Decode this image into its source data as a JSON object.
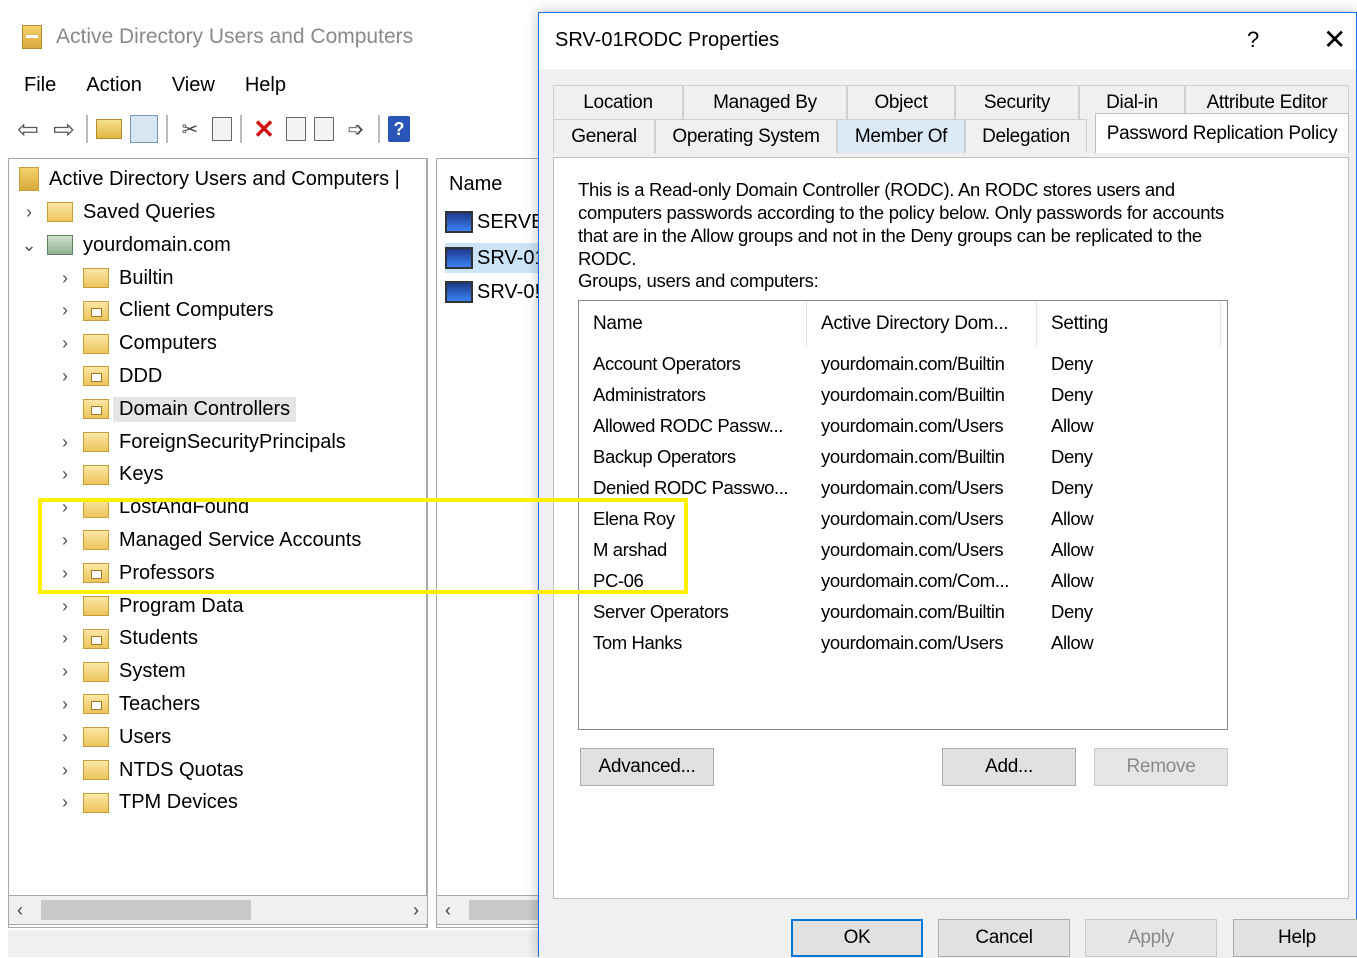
{
  "mmc": {
    "title": "Active Directory Users and Computers",
    "menu": [
      "File",
      "Action",
      "View",
      "Help"
    ],
    "tree": {
      "root": "Active Directory Users and Computers |",
      "saved_queries": "Saved Queries",
      "domain": "yourdomain.com",
      "children": [
        {
          "label": "Builtin",
          "ou": false
        },
        {
          "label": "Client Computers",
          "ou": true
        },
        {
          "label": "Computers",
          "ou": false
        },
        {
          "label": "DDD",
          "ou": true
        },
        {
          "label": "Domain Controllers",
          "ou": true,
          "selected": true
        },
        {
          "label": "ForeignSecurityPrincipals",
          "ou": false
        },
        {
          "label": "Keys",
          "ou": false
        },
        {
          "label": "LostAndFound",
          "ou": false
        },
        {
          "label": "Managed Service Accounts",
          "ou": false
        },
        {
          "label": "Professors",
          "ou": true
        },
        {
          "label": "Program Data",
          "ou": false
        },
        {
          "label": "Students",
          "ou": true
        },
        {
          "label": "System",
          "ou": false
        },
        {
          "label": "Teachers",
          "ou": true
        },
        {
          "label": "Users",
          "ou": false
        },
        {
          "label": "NTDS Quotas",
          "ou": false
        },
        {
          "label": "TPM Devices",
          "ou": false
        }
      ]
    },
    "list": {
      "header": "Name",
      "rows": [
        "SERVE",
        "SRV-01",
        "SRV-0!"
      ]
    }
  },
  "dialog": {
    "title": "SRV-01RODC Properties",
    "help": "?",
    "close": "✕",
    "tabs_row1": [
      "Location",
      "Managed By",
      "Object",
      "Security",
      "Dial-in",
      "Attribute Editor"
    ],
    "tabs_row2": [
      "General",
      "Operating System",
      "Member Of",
      "Delegation",
      "Password Replication Policy"
    ],
    "description": "This is a Read-only Domain Controller (RODC).  An RODC stores users and computers passwords according to the policy below.  Only passwords for accounts that are in the Allow groups and not in the Deny groups can be replicated to the RODC.",
    "groups_label": "Groups, users and computers:",
    "columns": [
      "Name",
      "Active Directory Dom...",
      "Setting"
    ],
    "rows": [
      {
        "name": "Account Operators",
        "domain": "yourdomain.com/Builtin",
        "setting": "Deny"
      },
      {
        "name": "Administrators",
        "domain": "yourdomain.com/Builtin",
        "setting": "Deny"
      },
      {
        "name": "Allowed RODC Passw...",
        "domain": "yourdomain.com/Users",
        "setting": "Allow"
      },
      {
        "name": "Backup Operators",
        "domain": "yourdomain.com/Builtin",
        "setting": "Deny"
      },
      {
        "name": "Denied RODC Passwo...",
        "domain": "yourdomain.com/Users",
        "setting": "Deny"
      },
      {
        "name": "Elena Roy",
        "domain": "yourdomain.com/Users",
        "setting": "Allow"
      },
      {
        "name": "M arshad",
        "domain": "yourdomain.com/Users",
        "setting": "Allow"
      },
      {
        "name": "PC-06",
        "domain": "yourdomain.com/Com...",
        "setting": "Allow"
      },
      {
        "name": "Server Operators",
        "domain": "yourdomain.com/Builtin",
        "setting": "Deny"
      },
      {
        "name": "Tom Hanks",
        "domain": "yourdomain.com/Users",
        "setting": "Allow"
      }
    ],
    "buttons": {
      "advanced": "Advanced...",
      "add": "Add...",
      "remove": "Remove",
      "ok": "OK",
      "cancel": "Cancel",
      "apply": "Apply",
      "help": "Help"
    },
    "highlight_color": "#ffef00"
  }
}
